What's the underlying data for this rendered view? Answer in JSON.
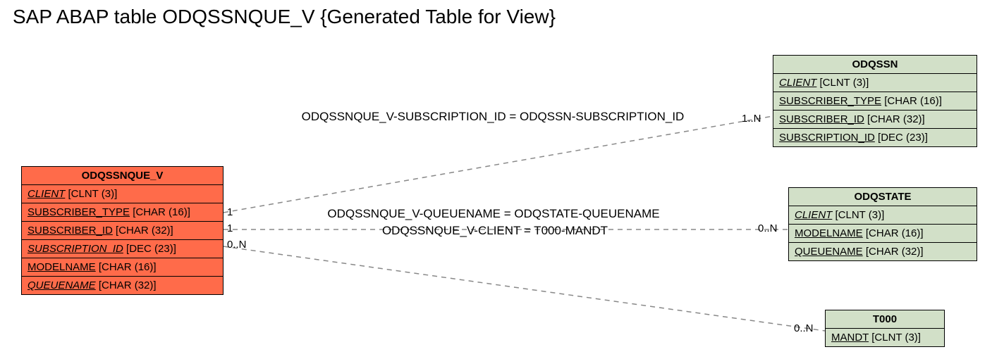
{
  "title": "SAP ABAP table ODQSSNQUE_V {Generated Table for View}",
  "main_table": {
    "name": "ODQSSNQUE_V",
    "fields": [
      {
        "name": "CLIENT",
        "type": "[CLNT (3)]",
        "italic": true
      },
      {
        "name": "SUBSCRIBER_TYPE",
        "type": "[CHAR (16)]",
        "italic": false
      },
      {
        "name": "SUBSCRIBER_ID",
        "type": "[CHAR (32)]",
        "italic": false
      },
      {
        "name": "SUBSCRIPTION_ID",
        "type": "[DEC (23)]",
        "italic": true
      },
      {
        "name": "MODELNAME",
        "type": "[CHAR (16)]",
        "italic": false
      },
      {
        "name": "QUEUENAME",
        "type": "[CHAR (32)]",
        "italic": true
      }
    ]
  },
  "ref_tables": [
    {
      "name": "ODQSSN",
      "fields": [
        {
          "name": "CLIENT",
          "type": "[CLNT (3)]",
          "italic": true
        },
        {
          "name": "SUBSCRIBER_TYPE",
          "type": "[CHAR (16)]",
          "italic": false
        },
        {
          "name": "SUBSCRIBER_ID",
          "type": "[CHAR (32)]",
          "italic": false
        },
        {
          "name": "SUBSCRIPTION_ID",
          "type": "[DEC (23)]",
          "italic": false
        }
      ]
    },
    {
      "name": "ODQSTATE",
      "fields": [
        {
          "name": "CLIENT",
          "type": "[CLNT (3)]",
          "italic": true
        },
        {
          "name": "MODELNAME",
          "type": "[CHAR (16)]",
          "italic": false
        },
        {
          "name": "QUEUENAME",
          "type": "[CHAR (32)]",
          "italic": false
        }
      ]
    },
    {
      "name": "T000",
      "fields": [
        {
          "name": "MANDT",
          "type": "[CLNT (3)]",
          "italic": false
        }
      ]
    }
  ],
  "relations": {
    "r1": {
      "label": "ODQSSNQUE_V-SUBSCRIPTION_ID = ODQSSN-SUBSCRIPTION_ID",
      "left_card": "1",
      "right_card": "1..N"
    },
    "r2": {
      "label": "ODQSSNQUE_V-QUEUENAME = ODQSTATE-QUEUENAME",
      "left_card": "1",
      "right_card": "0..N"
    },
    "r3": {
      "label": "ODQSSNQUE_V-CLIENT = T000-MANDT",
      "left_card": "0..N",
      "right_card": "0..N"
    }
  }
}
